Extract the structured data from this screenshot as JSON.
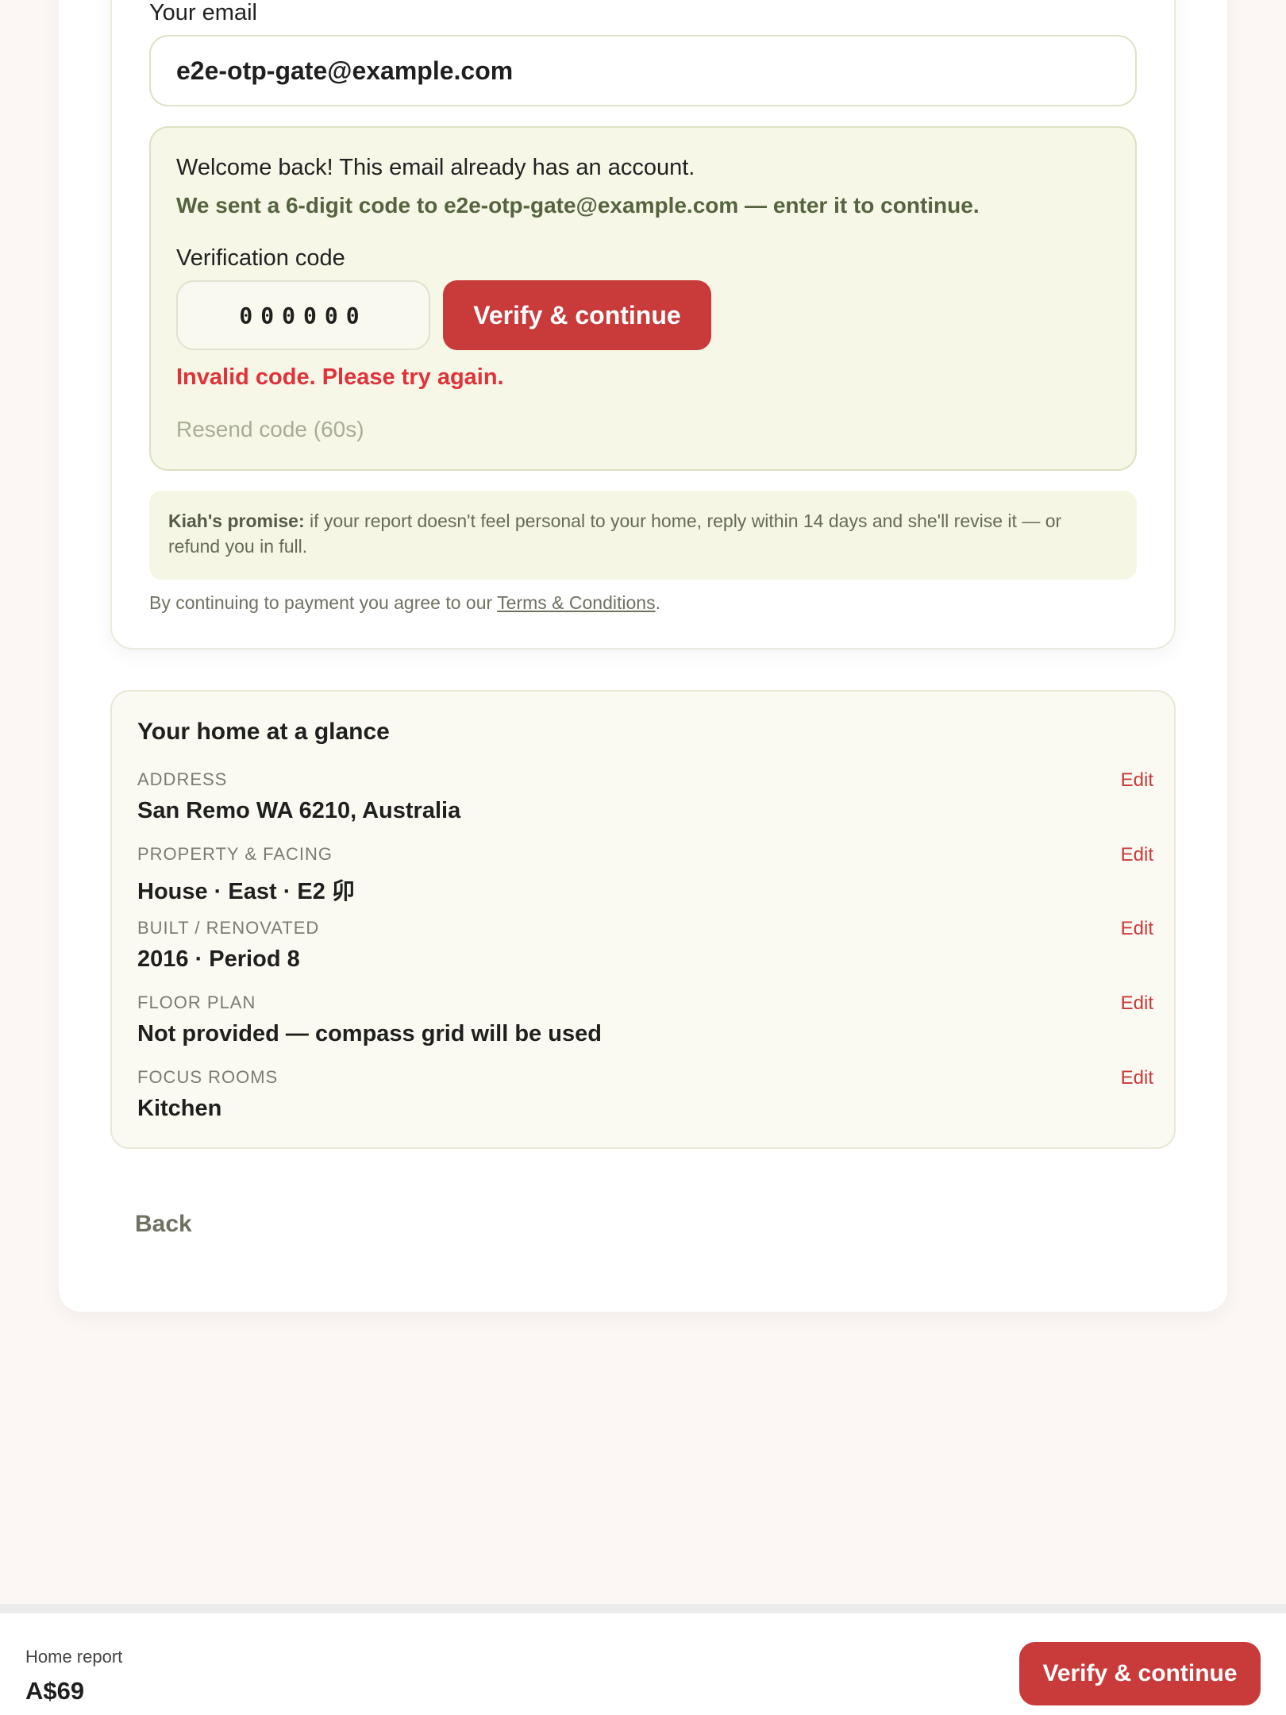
{
  "email": {
    "label": "Your email",
    "value": "e2e-otp-gate@example.com"
  },
  "otp": {
    "welcome": "Welcome back! This email already has an account.",
    "sent": "We sent a 6-digit code to e2e-otp-gate@example.com — enter it to continue.",
    "label": "Verification code",
    "placeholder": "000000",
    "verify_label": "Verify & continue",
    "error": "Invalid code. Please try again.",
    "resend": "Resend code (60s)"
  },
  "promise": {
    "lead": "Kiah's promise:",
    "text": "if your report doesn't feel personal to your home, reply within 14 days and she'll revise it — or refund you in full."
  },
  "terms": {
    "prefix": "By continuing to payment you agree to our",
    "link": "Terms & Conditions",
    "suffix": "."
  },
  "glance": {
    "title": "Your home at a glance",
    "edit_label": "Edit",
    "rows": [
      {
        "label": "ADDRESS",
        "value": "San Remo WA 6210, Australia"
      },
      {
        "label": "PROPERTY & FACING",
        "value": "House · East · E2 卯"
      },
      {
        "label": "BUILT / RENOVATED",
        "value": "2016 · Period 8"
      },
      {
        "label": "FLOOR PLAN",
        "value": "Not provided — compass grid will be used"
      },
      {
        "label": "FOCUS ROOMS",
        "value": "Kitchen"
      }
    ]
  },
  "back_label": "Back",
  "bottom_bar": {
    "label": "Home report",
    "price": "A$69",
    "button": "Verify & continue"
  }
}
